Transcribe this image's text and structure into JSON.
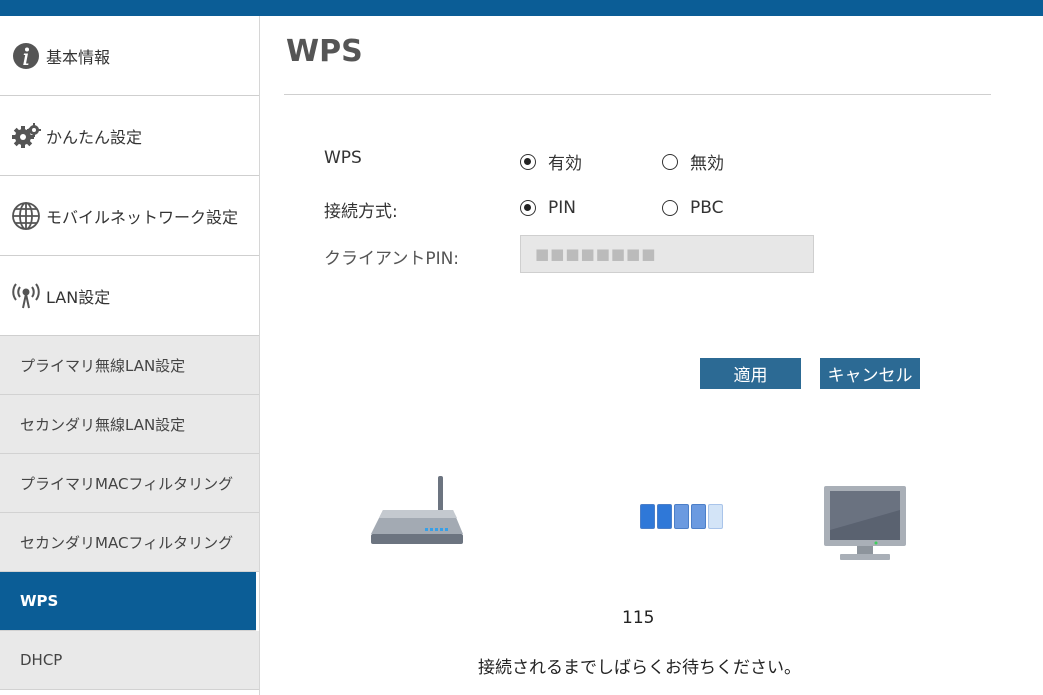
{
  "sidebar": {
    "main_items": [
      {
        "label": "基本情報",
        "icon": "info-icon"
      },
      {
        "label": "かんたん設定",
        "icon": "gear-icon"
      },
      {
        "label": "モバイルネットワーク設定",
        "icon": "globe-icon"
      },
      {
        "label": "LAN設定",
        "icon": "wireless-antenna-icon"
      }
    ],
    "sub_items": [
      {
        "label": "プライマリ無線LAN設定"
      },
      {
        "label": "セカンダリ無線LAN設定"
      },
      {
        "label": "プライマリMACフィルタリング"
      },
      {
        "label": "セカンダリMACフィルタリング"
      },
      {
        "label": "WPS",
        "active": true
      },
      {
        "label": "DHCP"
      }
    ]
  },
  "main": {
    "title": "WPS",
    "wps_row": {
      "label": "WPS",
      "options": [
        "有効",
        "無効"
      ],
      "selected": "有効"
    },
    "method_row": {
      "label": "接続方式:",
      "options": [
        "PIN",
        "PBC"
      ],
      "selected": "PIN"
    },
    "client_pin": {
      "label": "クライアントPIN:",
      "value": "■■■■■■■■"
    },
    "buttons": {
      "apply": "適用",
      "cancel": "キャンセル"
    },
    "progress": {
      "segments_total": 5,
      "segments_filled": 4
    },
    "countdown": "115",
    "wait_message": "接続されるまでしばらくお待ちください。"
  },
  "colors": {
    "accent": "#0b5d96",
    "button": "#2c6a94",
    "sidebar_sub_bg": "#e9e9e9"
  }
}
